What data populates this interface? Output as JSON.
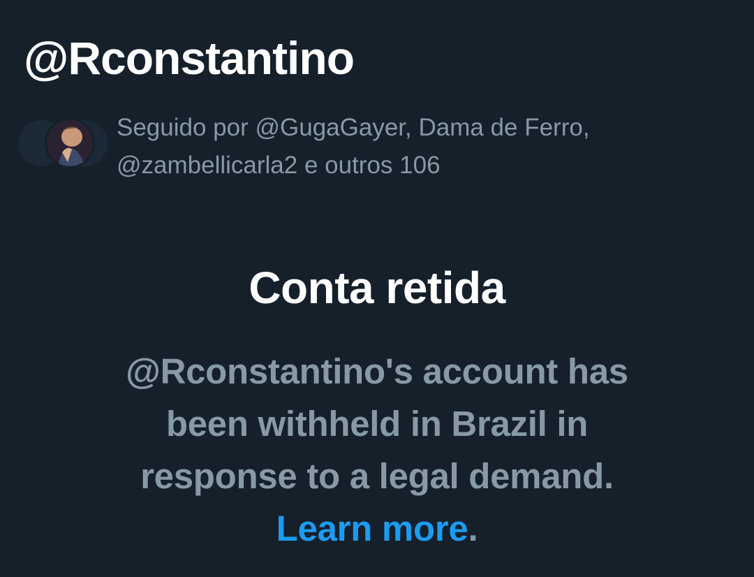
{
  "profile": {
    "handle": "@Rconstantino"
  },
  "followers": {
    "text": "Seguido por @GugaGayer, Dama de Ferro, @zambellicarla2 e outros 106"
  },
  "withheld": {
    "title": "Conta retida",
    "message": "@Rconstantino's account has been withheld in Brazil in response to a legal demand.",
    "learn_more": "Learn more",
    "period": "."
  },
  "colors": {
    "background": "#15202b",
    "secondary_text": "#8899a6",
    "link": "#1d9bf0"
  }
}
